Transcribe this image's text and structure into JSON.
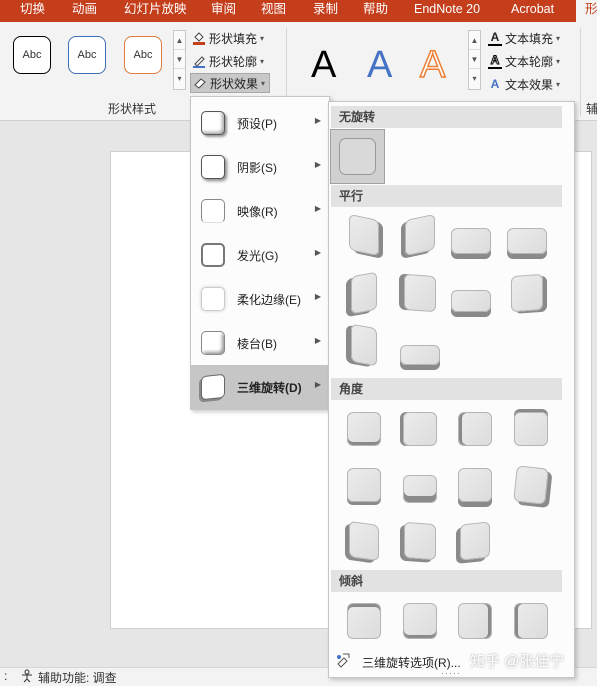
{
  "tabs": [
    {
      "label": "切换"
    },
    {
      "label": "动画"
    },
    {
      "label": "幻灯片放映"
    },
    {
      "label": "审阅"
    },
    {
      "label": "视图"
    },
    {
      "label": "录制"
    },
    {
      "label": "帮助"
    },
    {
      "label": "EndNote 20"
    },
    {
      "label": "Acrobat"
    },
    {
      "label": "形"
    }
  ],
  "ribbon": {
    "shape_styles": [
      {
        "label": "Abc",
        "color": "#000000"
      },
      {
        "label": "Abc",
        "color": "#3b6fb6"
      },
      {
        "label": "Abc",
        "color": "#e07b39"
      }
    ],
    "shape_fill": "形状填充",
    "shape_outline": "形状轮廓",
    "shape_effects": "形状效果",
    "shape_styles_group": "形状样式",
    "wordart": [
      {
        "label": "A",
        "color": "#000000"
      },
      {
        "label": "A",
        "color": "#4472c4"
      },
      {
        "label": "A",
        "color": "#ed7d31"
      }
    ],
    "text_fill": "文本填充",
    "text_outline": "文本轮廓",
    "text_effects": "文本效果",
    "cut_label": "辅"
  },
  "effects_menu": {
    "items": [
      {
        "label": "预设(P)"
      },
      {
        "label": "阴影(S)"
      },
      {
        "label": "映像(R)"
      },
      {
        "label": "发光(G)"
      },
      {
        "label": "柔化边缘(E)"
      },
      {
        "label": "棱台(B)"
      },
      {
        "label": "三维旋转(D)"
      }
    ],
    "selected": "三维旋转(D)"
  },
  "rotation_menu": {
    "sections": {
      "none": "无旋转",
      "parallel": "平行",
      "perspective": "角度",
      "oblique": "倾斜"
    },
    "options_label": "三维旋转选项(R)..."
  },
  "status": {
    "accessibility": "辅助功能: 调查"
  },
  "watermark": "知乎 @张佳宁",
  "colors": {
    "accent": "#c43e1c",
    "tile_face": "#dcdcdc",
    "tile_side": "#8a8a8a"
  }
}
